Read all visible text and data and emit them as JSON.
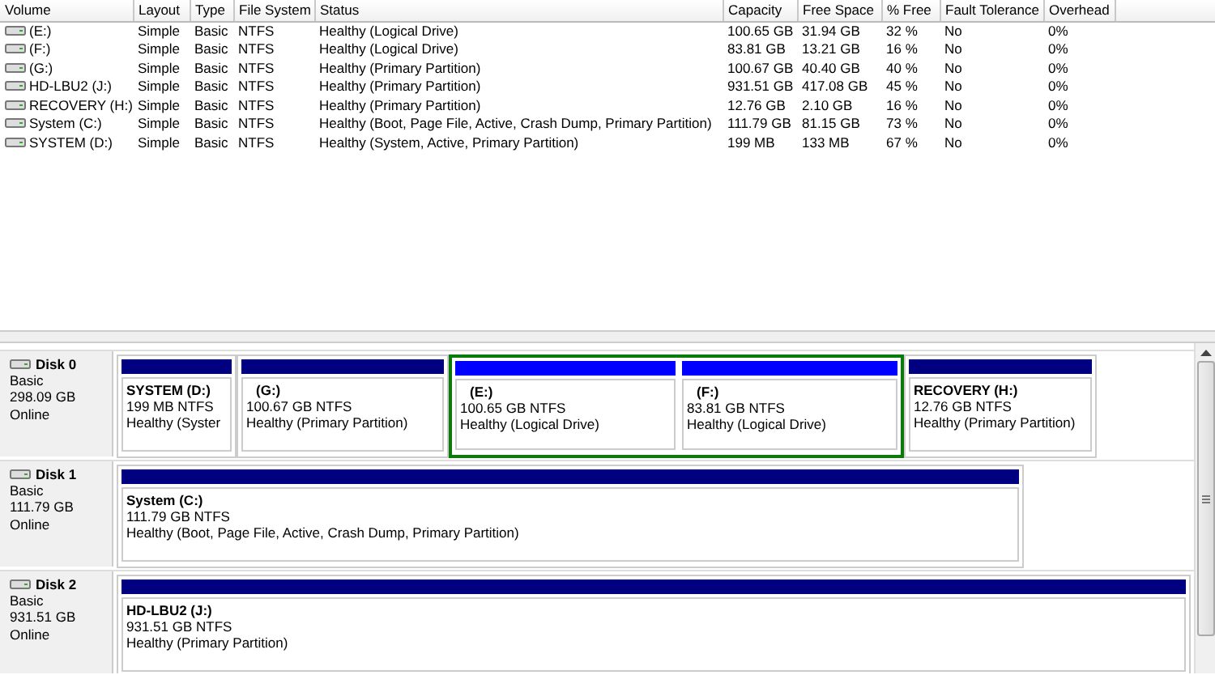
{
  "volume_table": {
    "columns": [
      "Volume",
      "Layout",
      "Type",
      "File System",
      "Status",
      "Capacity",
      "Free Space",
      "% Free",
      "Fault Tolerance",
      "Overhead"
    ],
    "rows": [
      {
        "cells": [
          "(E:)",
          "Simple",
          "Basic",
          "NTFS",
          "Healthy (Logical Drive)",
          "100.65 GB",
          "31.94 GB",
          "32 %",
          "No",
          "0%"
        ]
      },
      {
        "cells": [
          "(F:)",
          "Simple",
          "Basic",
          "NTFS",
          "Healthy (Logical Drive)",
          "83.81 GB",
          "13.21 GB",
          "16 %",
          "No",
          "0%"
        ]
      },
      {
        "cells": [
          "(G:)",
          "Simple",
          "Basic",
          "NTFS",
          "Healthy (Primary Partition)",
          "100.67 GB",
          "40.40 GB",
          "40 %",
          "No",
          "0%"
        ]
      },
      {
        "cells": [
          "HD-LBU2 (J:)",
          "Simple",
          "Basic",
          "NTFS",
          "Healthy (Primary Partition)",
          "931.51 GB",
          "417.08 GB",
          "45 %",
          "No",
          "0%"
        ]
      },
      {
        "cells": [
          "RECOVERY (H:)",
          "Simple",
          "Basic",
          "NTFS",
          "Healthy (Primary Partition)",
          "12.76 GB",
          "2.10 GB",
          "16 %",
          "No",
          "0%"
        ]
      },
      {
        "cells": [
          "System (C:)",
          "Simple",
          "Basic",
          "NTFS",
          "Healthy (Boot, Page File, Active, Crash Dump, Primary Partition)",
          "111.79 GB",
          "81.15 GB",
          "73 %",
          "No",
          "0%"
        ]
      },
      {
        "cells": [
          "SYSTEM (D:)",
          "Simple",
          "Basic",
          "NTFS",
          "Healthy (System, Active, Primary Partition)",
          "199 MB",
          "133 MB",
          "67 %",
          "No",
          "0%"
        ]
      }
    ]
  },
  "disks": [
    {
      "name": "Disk 0",
      "type": "Basic",
      "size": "298.09 GB",
      "state": "Online",
      "partitions": [
        {
          "kind": "primary",
          "name": "SYSTEM  (D:)",
          "size": "199 MB NTFS",
          "status": "Healthy (Syster"
        },
        {
          "kind": "primary",
          "name": "(G:)",
          "size": "100.67 GB NTFS",
          "status": "Healthy (Primary Partition)"
        },
        {
          "kind": "logical",
          "name": "(E:)",
          "size": "100.65 GB NTFS",
          "status": "Healthy (Logical Drive)"
        },
        {
          "kind": "logical",
          "name": "(F:)",
          "size": "83.81 GB NTFS",
          "status": "Healthy (Logical Drive)"
        },
        {
          "kind": "primary",
          "name": "RECOVERY  (H:)",
          "size": "12.76 GB NTFS",
          "status": "Healthy (Primary Partition)"
        }
      ]
    },
    {
      "name": "Disk 1",
      "type": "Basic",
      "size": "111.79 GB",
      "state": "Online",
      "partitions": [
        {
          "kind": "primary",
          "name": "System  (C:)",
          "size": "111.79 GB NTFS",
          "status": "Healthy (Boot, Page File, Active, Crash Dump, Primary Partition)"
        }
      ]
    },
    {
      "name": "Disk 2",
      "type": "Basic",
      "size": "931.51 GB",
      "state": "Online",
      "partitions": [
        {
          "kind": "primary",
          "name": "HD-LBU2  (J:)",
          "size": "931.51 GB NTFS",
          "status": "Healthy (Primary Partition)"
        }
      ]
    }
  ]
}
